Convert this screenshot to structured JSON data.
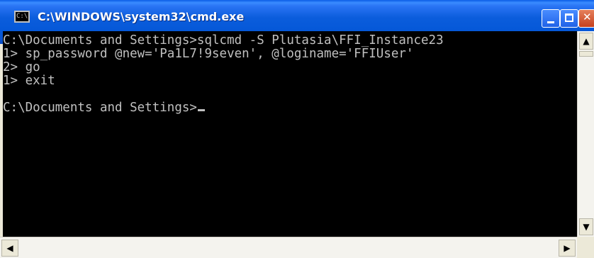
{
  "window": {
    "title": "C:\\WINDOWS\\system32\\cmd.exe",
    "icon_label": "C:\\",
    "controls": {
      "minimize": "minimize-icon",
      "maximize": "maximize-icon",
      "close": "close-icon"
    }
  },
  "console": {
    "lines": [
      "C:\\Documents and Settings>sqlcmd -S Plutasia\\FFI_Instance23",
      "1> sp_password @new='Pa1L7!9seven', @loginame='FFIUser'",
      "2> go",
      "1> exit",
      "",
      "C:\\Documents and Settings>"
    ]
  },
  "scrollbars": {
    "up": "▲",
    "down": "▼",
    "left": "◀",
    "right": "▶"
  },
  "colors": {
    "titlebar": "#0558d8",
    "console_bg": "#000000",
    "console_fg": "#c0c0c0"
  }
}
